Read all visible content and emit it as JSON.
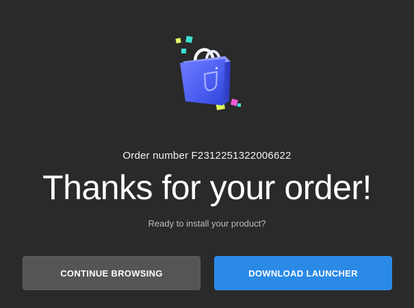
{
  "order": {
    "number_text": "Order number F2312251322006622"
  },
  "heading": {
    "title": "Thanks for your order!",
    "subtitle": "Ready to install your product?"
  },
  "actions": {
    "continue_label": "CONTINUE BROWSING",
    "download_label": "DOWNLOAD LAUNCHER"
  },
  "icons": {
    "illustration": "shopping-bag-icon"
  },
  "colors": {
    "background": "#2a2a2a",
    "primary_button": "#2a8ae6",
    "secondary_button": "#555555"
  }
}
